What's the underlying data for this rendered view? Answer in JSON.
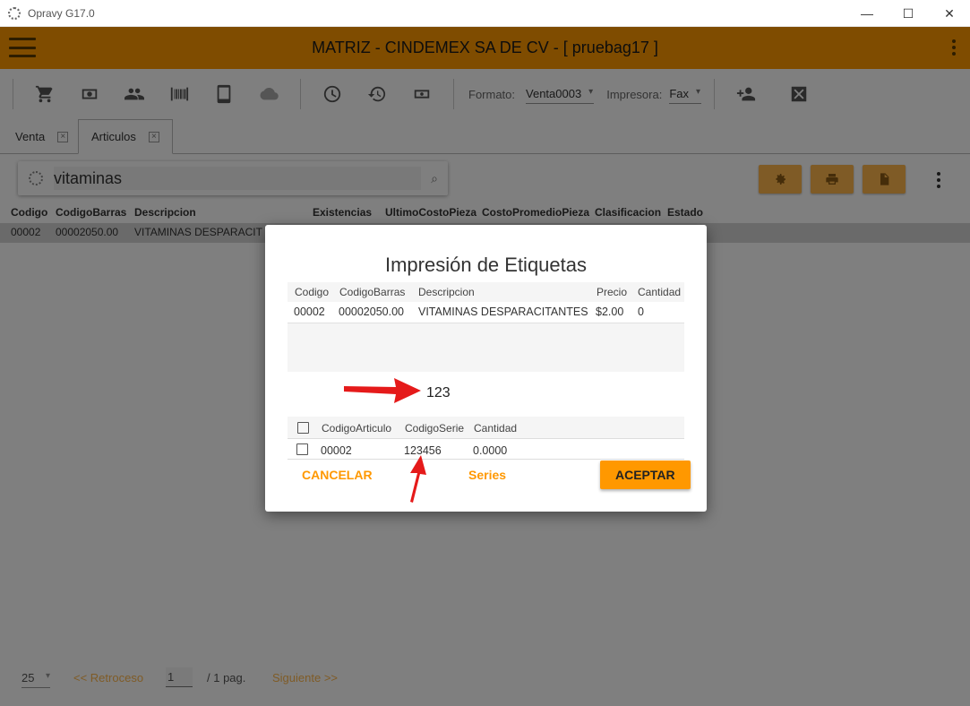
{
  "window": {
    "title": "Opravy G17.0",
    "minimize_glyph": "—",
    "maximize_glyph": "☐",
    "close_glyph": "✕"
  },
  "appbar": {
    "title": "MATRIZ - CINDEMEX SA DE CV - [ pruebag17 ]"
  },
  "toolbar": {
    "icons": [
      "cart-icon",
      "cash-icon",
      "people-icon",
      "barcode-icon",
      "tablet-icon",
      "cloud-sync-icon",
      "clock-icon",
      "history-icon",
      "money-icon"
    ],
    "formato_label": "Formato:",
    "formato_value": "Venta0003",
    "impresora_label": "Impresora:",
    "impresora_value": "Fax",
    "extra_icons": [
      "person-add-icon",
      "close-box-icon"
    ]
  },
  "tabs": [
    {
      "label": "Venta"
    },
    {
      "label": "Articulos"
    }
  ],
  "search": {
    "value": "vitaminas"
  },
  "grid": {
    "columns": [
      "Codigo",
      "CodigoBarras",
      "Descripcion",
      "Existencias",
      "UltimoCostoPieza",
      "CostoPromedioPieza",
      "Clasificacion",
      "Estado"
    ],
    "rows": [
      {
        "codigo": "00002",
        "codigo_barras": "00002050.00",
        "descripcion": "VITAMINAS DESPARACIT"
      }
    ]
  },
  "pager": {
    "page_size": "25",
    "prev": "<<  Retroceso",
    "page": "1",
    "of": "/  1  pag.",
    "next": "Siguiente  >>"
  },
  "dialog": {
    "title": "Impresión de Etiquetas",
    "table": {
      "columns": [
        "Codigo",
        "CodigoBarras",
        "Descripcion",
        "Precio",
        "Cantidad"
      ],
      "row": [
        "00002",
        "00002050.00",
        "VITAMINAS DESPARACITANTES",
        "$2.00",
        "0"
      ]
    },
    "scan_value": "123",
    "series_table": {
      "columns": [
        "CodigoArticulo",
        "CodigoSerie",
        "Cantidad"
      ],
      "row": [
        "00002",
        "123456",
        "0.0000"
      ]
    },
    "buttons": {
      "cancel": "CANCELAR",
      "series": "Series",
      "accept": "ACEPTAR"
    }
  },
  "colors": {
    "accent": "#FF9800",
    "accent_light": "#FFB74D",
    "annotation_arrow": "#E51A1A"
  }
}
